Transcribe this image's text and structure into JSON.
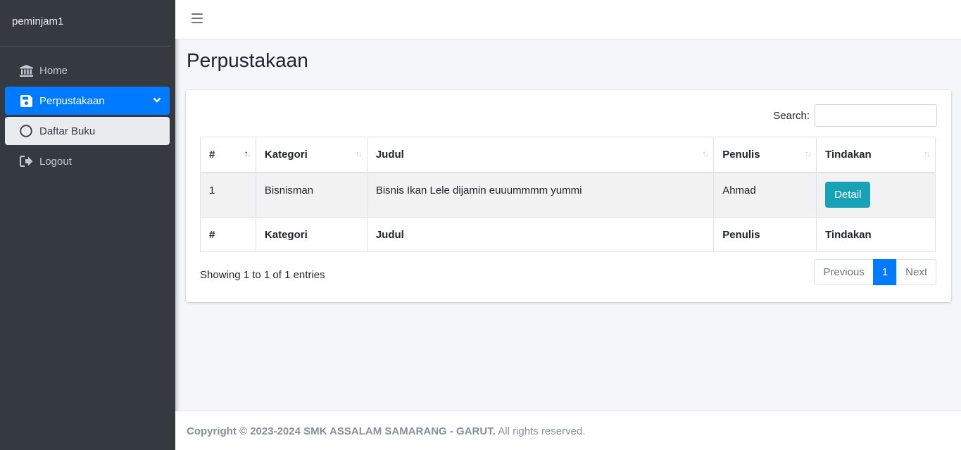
{
  "sidebar": {
    "user": "peminjam1",
    "items": [
      {
        "label": "Home",
        "icon": "bank-icon"
      },
      {
        "label": "Perpustakaan",
        "icon": "save-icon",
        "active": true
      },
      {
        "label": "Daftar Buku",
        "icon": "circle-icon"
      },
      {
        "label": "Logout",
        "icon": "sign-out-icon"
      }
    ]
  },
  "page": {
    "title": "Perpustakaan"
  },
  "search": {
    "label": "Search:",
    "value": ""
  },
  "table": {
    "headers": [
      "#",
      "Kategori",
      "Judul",
      "Penulis",
      "Tindakan"
    ],
    "rows": [
      {
        "no": "1",
        "kategori": "Bisnisman",
        "judul": "Bisnis Ikan Lele dijamin euuummmm yummi",
        "penulis": "Ahmad",
        "action": "Detail"
      }
    ],
    "footer": [
      "#",
      "Kategori",
      "Judul",
      "Penulis",
      "Tindakan"
    ]
  },
  "info": "Showing 1 to 1 of 1 entries",
  "pagination": {
    "previous": "Previous",
    "current": "1",
    "next": "Next"
  },
  "footer": {
    "copyright": "Copyright © 2023-2024 SMK ASSALAM SAMARANG - GARUT.",
    "rights": " All rights reserved."
  },
  "colors": {
    "primary": "#007bff",
    "info": "#17a2b8",
    "sidebar": "#343a40"
  }
}
